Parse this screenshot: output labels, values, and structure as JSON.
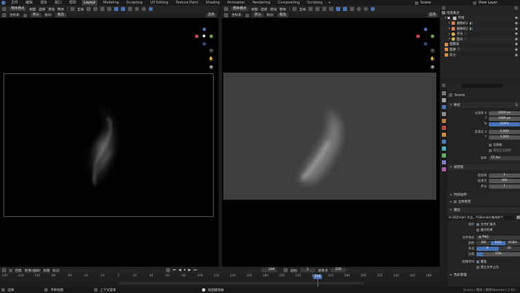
{
  "topbar": {
    "menus": [
      "文件",
      "编辑",
      "渲染",
      "窗口",
      "帮助"
    ],
    "tabs": [
      "Layout",
      "Modeling",
      "Sculpting",
      "UV Editing",
      "Texture Paint",
      "Shading",
      "Animation",
      "Rendering",
      "Compositing",
      "Scripting"
    ],
    "active_tab": "Layout",
    "plus": "+",
    "scene": "Scene",
    "view_layer": "View Layer"
  },
  "left_view": {
    "mode": "物体模式",
    "menus": [
      "视图",
      "选择",
      "添加",
      "物体"
    ],
    "orientation": "全局",
    "sub": [
      "坐标系:",
      "默认",
      "拖动:",
      "框选"
    ],
    "options": "选项"
  },
  "right_view": {
    "mode": "物体模式",
    "menus": [
      "视图",
      "选择",
      "添加",
      "物体"
    ],
    "orientation": "全局",
    "sub": [
      "坐标系:",
      "默认",
      "拖动:",
      "框选"
    ],
    "options": "选项"
  },
  "outliner": {
    "title": "场景集合",
    "items": [
      {
        "label": "环境",
        "indent": 1
      },
      {
        "label": "摄像机1",
        "indent": 2
      },
      {
        "label": "摄像机2",
        "indent": 2
      },
      {
        "label": "点光",
        "indent": 2
      },
      {
        "label": "面光",
        "indent": 2
      },
      {
        "label": "烟雾域",
        "indent": 1
      },
      {
        "label": "烟源",
        "indent": 1
      },
      {
        "label": "风力",
        "indent": 1
      }
    ]
  },
  "properties": {
    "scene_name": "Scene",
    "format_header": "格式",
    "res_x_label": "分辨率 X",
    "res_x": "1920 px",
    "y_label": "Y",
    "res_y": "1080 px",
    "pct_label": "%",
    "res_pct": "200%",
    "aspect_x_label": "宽高比 X",
    "aspect_x": "1.000",
    "aspect_y_label": "Y",
    "aspect_y": "1.000",
    "border_label": "渲染框",
    "crop_label": "裁剪至渲染框",
    "fps_label": "帧率",
    "fps": "25 fps",
    "frame_range_header": "帧范围",
    "start_label": "起始帧",
    "frame_start": "1",
    "end_label": "结束点",
    "frame_end": "300",
    "step_label": "步长",
    "frame_step": "1",
    "time_stretch": "时间拉伸",
    "stereoscopy": "立体视觉",
    "output_header": "输出",
    "output_path": "H:\\项目\\Vphi 作品...气\\Blender\\咖啡热气",
    "saving_label": "保存",
    "file_ext": "文件扩展名",
    "cache_result": "缓存结果",
    "file_format_label": "文件格式",
    "file_format": "PNG",
    "color_label": "颜色",
    "color_opts": [
      "BW",
      "RGB",
      "RGBA"
    ],
    "color_active": "RGB",
    "depth_label": "色深",
    "depth_opts": [
      "8",
      "16"
    ],
    "compress_label": "压缩",
    "compress": "15%",
    "image_seq_label": "图像序列",
    "overwrite": "覆盖",
    "placeholders": "建立文件占位",
    "color_mgmt": "色彩管理"
  },
  "timeline": {
    "menus": [
      "回放",
      "抠像(插帧)",
      "视图",
      "标记"
    ],
    "current_frame": "244",
    "start_label": "起始",
    "start": "1",
    "end_label": "结束点",
    "end": "300",
    "ticks": [
      "-140",
      "-120",
      "-100",
      "-80",
      "-60",
      "-40",
      "-20",
      "0",
      "20",
      "40",
      "60",
      "80",
      "100",
      "120",
      "140",
      "160",
      "180",
      "200",
      "220",
      "240",
      "260",
      "280",
      "300",
      "320",
      "340",
      "360",
      "380"
    ]
  },
  "statusbar": {
    "items": [
      "选择",
      "平移视图",
      "上下文菜单"
    ],
    "center": "动画播放器",
    "right": "Scene | 物体 | 精简(Blender) 2.93..."
  }
}
